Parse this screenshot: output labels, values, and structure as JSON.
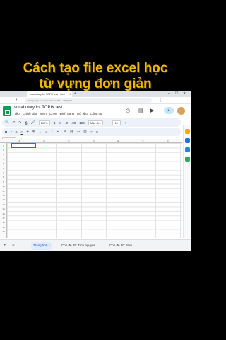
{
  "overlay": {
    "line1": "Cách tạo file excel học",
    "line2": "từ vựng đơn giản"
  },
  "browser": {
    "tab_title": "vocabulary for TOPIK test - Goo",
    "url": "docs.google.com/spreadsheets/d/1...edit#gid=0"
  },
  "doc": {
    "title": "vocabulary for TOPIK test",
    "menu": [
      "Tệp",
      "Chỉnh sửa",
      "Xem",
      "Chèn",
      "Định dạng",
      "Dữ liệu",
      "Công cụ"
    ]
  },
  "toolbar": {
    "zoom": "100%",
    "number_format": "123",
    "font": "Mặc đị...",
    "font_size": "10"
  },
  "formula": {
    "namebox": "A1",
    "fx": "fx"
  },
  "grid": {
    "columns": [
      "A",
      "B",
      "C",
      "D",
      "E",
      "F",
      "G"
    ],
    "rows": [
      "1",
      "2",
      "3",
      "4",
      "5",
      "6",
      "7",
      "8",
      "9",
      "10",
      "11",
      "12",
      "13",
      "14",
      "15",
      "16",
      "17",
      "18",
      "19",
      "20"
    ]
  },
  "sheets": [
    {
      "label": "Trang tính 1",
      "active": true
    },
    {
      "label": "Chủ đề 29: Tình nguyện",
      "active": false
    },
    {
      "label": "Chủ đề 30: Nhớ",
      "active": false
    }
  ],
  "colors": {
    "title": "#f2b705",
    "sheets_green": "#0f9d58",
    "selection": "#1a73e8"
  }
}
